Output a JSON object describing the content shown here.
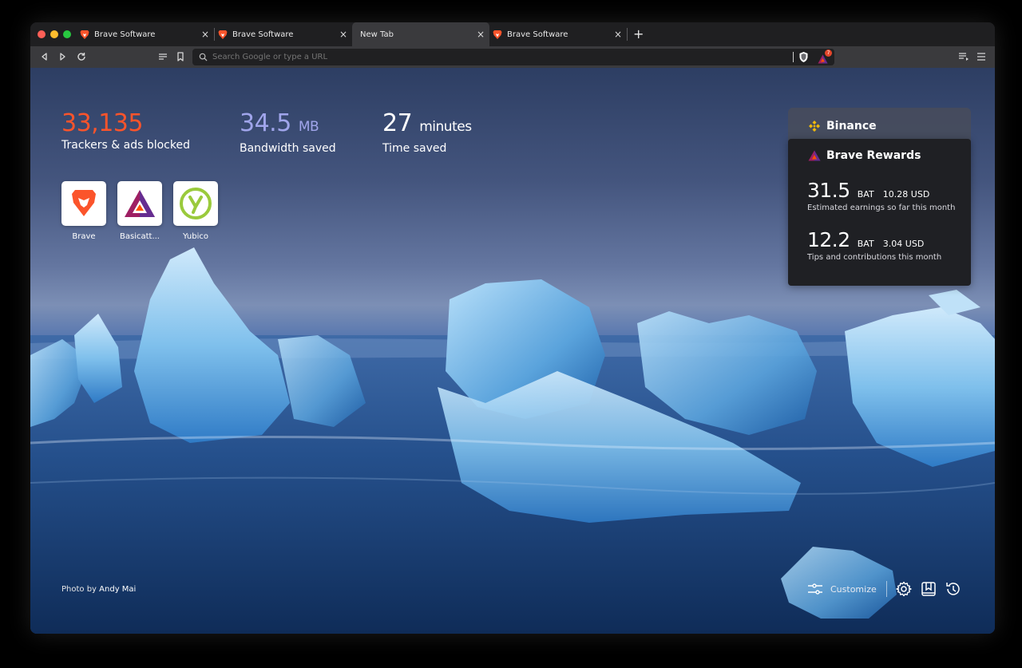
{
  "browser": {
    "tabs": [
      {
        "title": "Brave Software",
        "active": false
      },
      {
        "title": "Brave Software",
        "active": false
      },
      {
        "title": "New Tab",
        "active": true
      },
      {
        "title": "Brave Software",
        "active": false
      }
    ],
    "new_tab_symbol": "+",
    "close_symbol": "×",
    "url_placeholder": "Search Google or type a URL",
    "rewards_badge": "7"
  },
  "stats": {
    "trackers": {
      "value": "33,135",
      "label": "Trackers & ads blocked",
      "color": "#fb542b"
    },
    "bandwidth": {
      "value": "34.5",
      "unit": "MB",
      "label": "Bandwidth saved",
      "color": "#a0a5eb"
    },
    "time": {
      "value": "27",
      "unit": "minutes",
      "label": "Time saved",
      "color": "#ffffff"
    }
  },
  "top_sites": [
    {
      "label": "Brave",
      "icon": "brave-lion-icon"
    },
    {
      "label": "Basicatt...",
      "icon": "bat-triangle-icon"
    },
    {
      "label": "Yubico",
      "icon": "yubico-y-icon"
    }
  ],
  "widgets": {
    "binance": {
      "title": "Binance",
      "accent": "#f0b90b"
    },
    "rewards": {
      "title": "Brave Rewards",
      "earnings": {
        "amount": "31.5",
        "currency": "BAT",
        "usd": "10.28 USD",
        "label": "Estimated earnings so far this month"
      },
      "tips": {
        "amount": "12.2",
        "currency": "BAT",
        "usd": "3.04 USD",
        "label": "Tips and contributions this month"
      }
    }
  },
  "footer": {
    "photo_prefix": "Photo by",
    "photographer": "Andy Mai",
    "customize_label": "Customize"
  }
}
